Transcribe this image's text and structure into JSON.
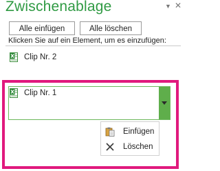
{
  "pane": {
    "title": "Zwischenablage",
    "dropdown_glyph": "▼",
    "close_glyph": "✕"
  },
  "toolbar": {
    "paste_all_label": "Alle einfügen",
    "clear_all_label": "Alle löschen"
  },
  "instruction": "Klicken Sie auf ein Element, um es einzufügen:",
  "clips": [
    {
      "label": "Clip Nr. 2",
      "icon": "excel-icon"
    },
    {
      "label": "Clip Nr. 1",
      "icon": "excel-icon"
    }
  ],
  "context_menu": {
    "items": [
      {
        "label": "Einfügen",
        "icon": "paste-icon"
      },
      {
        "label": "Löschen",
        "icon": "delete-icon"
      }
    ]
  },
  "colors": {
    "title": "#2f9a43",
    "highlight": "#e0197d",
    "dropdown": "#5fae4b"
  }
}
